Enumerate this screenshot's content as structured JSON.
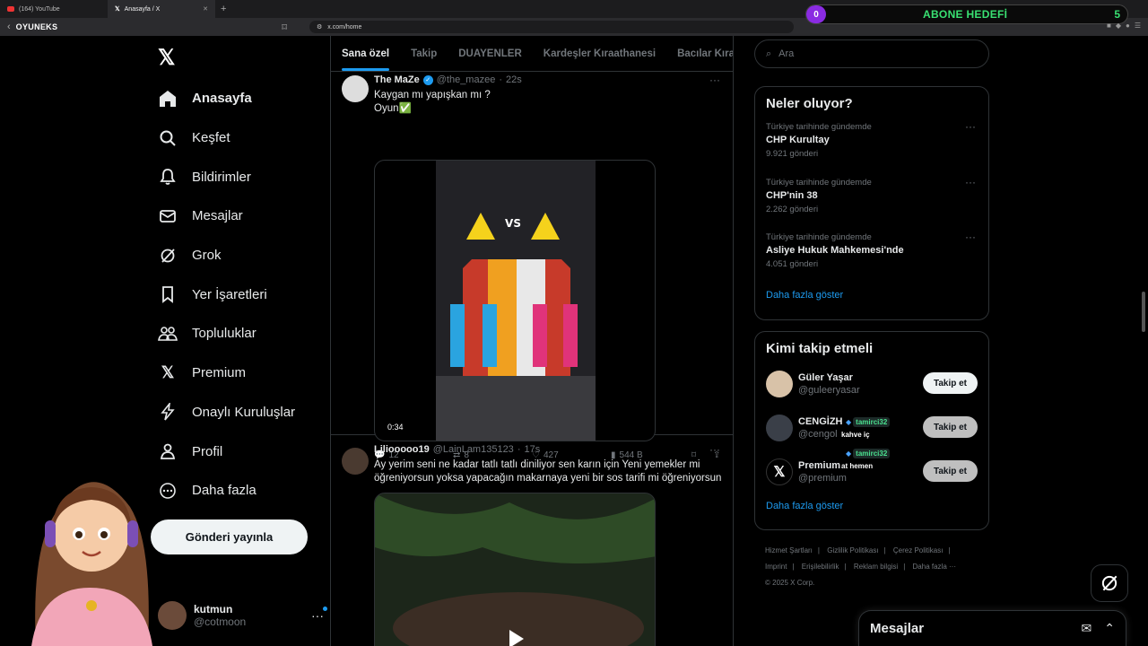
{
  "browser": {
    "tabs": [
      {
        "label": "(164) YouTube"
      },
      {
        "label": "Anasayfa / X"
      }
    ],
    "url": "x.com/home",
    "brand": "OYUNEKS"
  },
  "overlay": {
    "abone_level": "0",
    "abone_label": "ABONE HEDEFİ",
    "abone_target": "5",
    "chat": [
      {
        "user": "tamirci32",
        "message": "kahve iç"
      },
      {
        "user": "tamirci32",
        "message": "at hemen"
      }
    ]
  },
  "nav": {
    "logo": "𝕏",
    "items": [
      {
        "label": "Anasayfa",
        "icon": "home-icon"
      },
      {
        "label": "Keşfet",
        "icon": "search-icon"
      },
      {
        "label": "Bildirimler",
        "icon": "bell-icon"
      },
      {
        "label": "Mesajlar",
        "icon": "mail-icon"
      },
      {
        "label": "Grok",
        "icon": "grok-icon"
      },
      {
        "label": "Yer İşaretleri",
        "icon": "bookmark-icon"
      },
      {
        "label": "Topluluklar",
        "icon": "communities-icon"
      },
      {
        "label": "Premium",
        "icon": "x-premium-icon"
      },
      {
        "label": "Onaylı Kuruluşlar",
        "icon": "lightning-icon"
      },
      {
        "label": "Profil",
        "icon": "person-icon"
      },
      {
        "label": "Daha fazla",
        "icon": "more-circle-icon"
      }
    ],
    "post_button": "Gönderi yayınla",
    "account": {
      "name": "kutmun",
      "handle": "@cotmoon"
    }
  },
  "feed": {
    "tabs": [
      "Sana özel",
      "Takip",
      "DUAYENLER",
      "Kardeşler Kıraathanesi",
      "Bacılar Kıraath"
    ],
    "tweets": [
      {
        "name": "The MaZe",
        "handle": "@the_mazee",
        "time": "22s",
        "text_line1": "Kaygan mı yapışkan mı ?",
        "text_line2": "Oyun✅",
        "video_duration": "0:34",
        "replies": "12",
        "retweets": "8",
        "likes": "427",
        "views": "544 B"
      },
      {
        "name": "Liliooooo19",
        "handle": "@LainLam135123",
        "time": "17s",
        "text_line1": "Ay yerim seni ne kadar tatlı tatlı diniliyor sen karın için Yeni yemekler mi",
        "text_line2": "öğreniyorsun yoksa yapacağın makarnaya yeni bir sos tarifi mi öğreniyorsun"
      }
    ]
  },
  "sidebar": {
    "search_placeholder": "Ara",
    "trends_title": "Neler oluyor?",
    "trends": [
      {
        "context": "Türkiye tarihinde gündemde",
        "title": "CHP Kurultay",
        "count": "9.921 gönderi"
      },
      {
        "context": "Türkiye tarihinde gündemde",
        "title": "CHP'nin 38",
        "count": "2.262 gönderi"
      },
      {
        "context": "Türkiye tarihinde gündemde",
        "title": "Asliye Hukuk Mahkemesi'nde",
        "count": "4.051 gönderi"
      }
    ],
    "trends_more": "Daha fazla göster",
    "who_title": "Kimi takip etmeli",
    "who": [
      {
        "name": "Güler Yaşar",
        "handle": "@guleeryasar",
        "button": "Takip et"
      },
      {
        "name": "CENGİZH",
        "handle": "@cengol",
        "button": "Takip et"
      },
      {
        "name": "Premium",
        "handle": "@premium",
        "button": "Takip et"
      }
    ],
    "who_more": "Daha fazla göster",
    "footer": [
      "Hizmet Şartları",
      "Gizlilik Politikası",
      "Çerez Politikası",
      "Imprint",
      "Erişilebilirlik",
      "Reklam bilgisi",
      "Daha fazla ···",
      "© 2025 X Corp."
    ]
  },
  "messages_drawer": {
    "title": "Mesajlar"
  }
}
